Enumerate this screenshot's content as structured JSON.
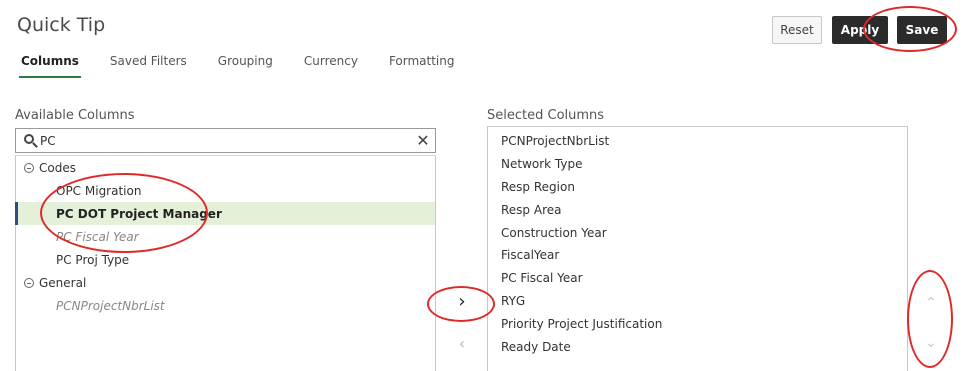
{
  "header": {
    "title": "Quick Tip"
  },
  "toolbar": {
    "reset_label": "Reset",
    "apply_label": "Apply",
    "save_label": "Save"
  },
  "tabs": [
    {
      "label": "Columns"
    },
    {
      "label": "Saved Filters"
    },
    {
      "label": "Grouping"
    },
    {
      "label": "Currency"
    },
    {
      "label": "Formatting"
    }
  ],
  "available": {
    "label": "Available Columns",
    "search": {
      "value": "PC",
      "placeholder": ""
    },
    "groups": [
      {
        "label": "Codes",
        "items": [
          "OPC Migration",
          "PC DOT Project Manager",
          "PC Fiscal Year",
          "PC Proj Type"
        ]
      },
      {
        "label": "General",
        "items": [
          "PCNProjectNbrList"
        ]
      }
    ]
  },
  "selected": {
    "label": "Selected Columns",
    "items": [
      "PCNProjectNbrList",
      "Network Type",
      "Resp Region",
      "Resp Area",
      "Construction Year",
      "FiscalYear",
      "PC Fiscal Year",
      "RYG",
      "Priority Project Justification",
      "Ready Date"
    ]
  },
  "icons": {
    "search": "search-icon",
    "clear": "close-icon",
    "move_right": "chevron-right-icon",
    "move_left": "chevron-left-icon",
    "move_up": "chevron-up-icon",
    "move_down": "chevron-down-icon",
    "group_toggle": "collapse-icon"
  },
  "colors": {
    "primary_button": "#2b2b2b",
    "active_tab_underline": "#2f7a3c",
    "selected_row_bg": "#e4f0d8",
    "selected_row_marker": "#2d4f7a",
    "annotation": "#e02a2a"
  }
}
